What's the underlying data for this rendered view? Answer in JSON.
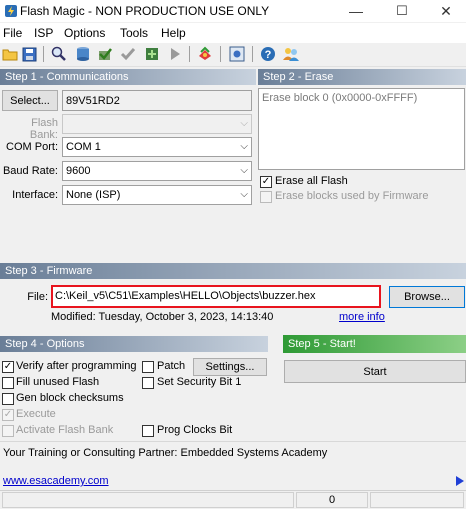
{
  "window": {
    "title": "Flash Magic - NON PRODUCTION USE ONLY",
    "minimize": "—",
    "maximize": "☐",
    "close": "✕"
  },
  "menu": [
    "File",
    "ISP",
    "Options",
    "Tools",
    "Help"
  ],
  "toolbar": {
    "icons": [
      "open-icon",
      "save-icon",
      "search-icon",
      "blank-check-icon",
      "erase-icon",
      "verify-icon",
      "program-icon",
      "go-icon",
      "tools-icon",
      "window-icon",
      "help-icon",
      "users-icon"
    ]
  },
  "step1": {
    "header": "Step 1 - Communications",
    "select_button": "Select...",
    "device": "89V51RD2",
    "flash_bank_label": "Flash Bank:",
    "com_port_label": "COM Port:",
    "com_port_value": "COM 1",
    "baud_rate_label": "Baud Rate:",
    "baud_rate_value": "9600",
    "interface_label": "Interface:",
    "interface_value": "None (ISP)"
  },
  "step2": {
    "header": "Step 2 - Erase",
    "erase_list_item": "Erase block 0 (0x0000-0xFFFF)",
    "erase_all_label": "Erase all Flash",
    "erase_all_checked": true,
    "erase_used_label": "Erase blocks used by Firmware",
    "erase_used_checked": false
  },
  "step3": {
    "header": "Step 3 - Firmware",
    "file_label": "File:",
    "file_path": "C:\\Keil_v5\\C51\\Examples\\HELLO\\Objects\\buzzer.hex",
    "browse_button": "Browse...",
    "modified_text": "Modified: Tuesday, October 3, 2023, 14:13:40",
    "more_info_link": "more info"
  },
  "step4": {
    "header": "Step 4 - Options",
    "verify_label": "Verify after programming",
    "verify_checked": true,
    "fill_unused_label": "Fill unused Flash",
    "gen_checksums_label": "Gen block checksums",
    "execute_label": "Execute",
    "activate_bank_label": "Activate Flash Bank",
    "patch_label": "Patch",
    "settings_button": "Settings...",
    "security_label": "Set Security Bit 1",
    "prog_clocks_label": "Prog Clocks Bit"
  },
  "step5": {
    "header": "Step 5 - Start!",
    "start_button": "Start"
  },
  "footer": {
    "partner_text": "Your Training or Consulting Partner: Embedded Systems Academy",
    "link_text": "www.esacademy.com",
    "status_value": "0"
  },
  "colors": {
    "section_bar": "#6a7e97",
    "step5_bar": "#2e9a35",
    "highlight_red": "#e8141e",
    "link": "#0000cc"
  }
}
